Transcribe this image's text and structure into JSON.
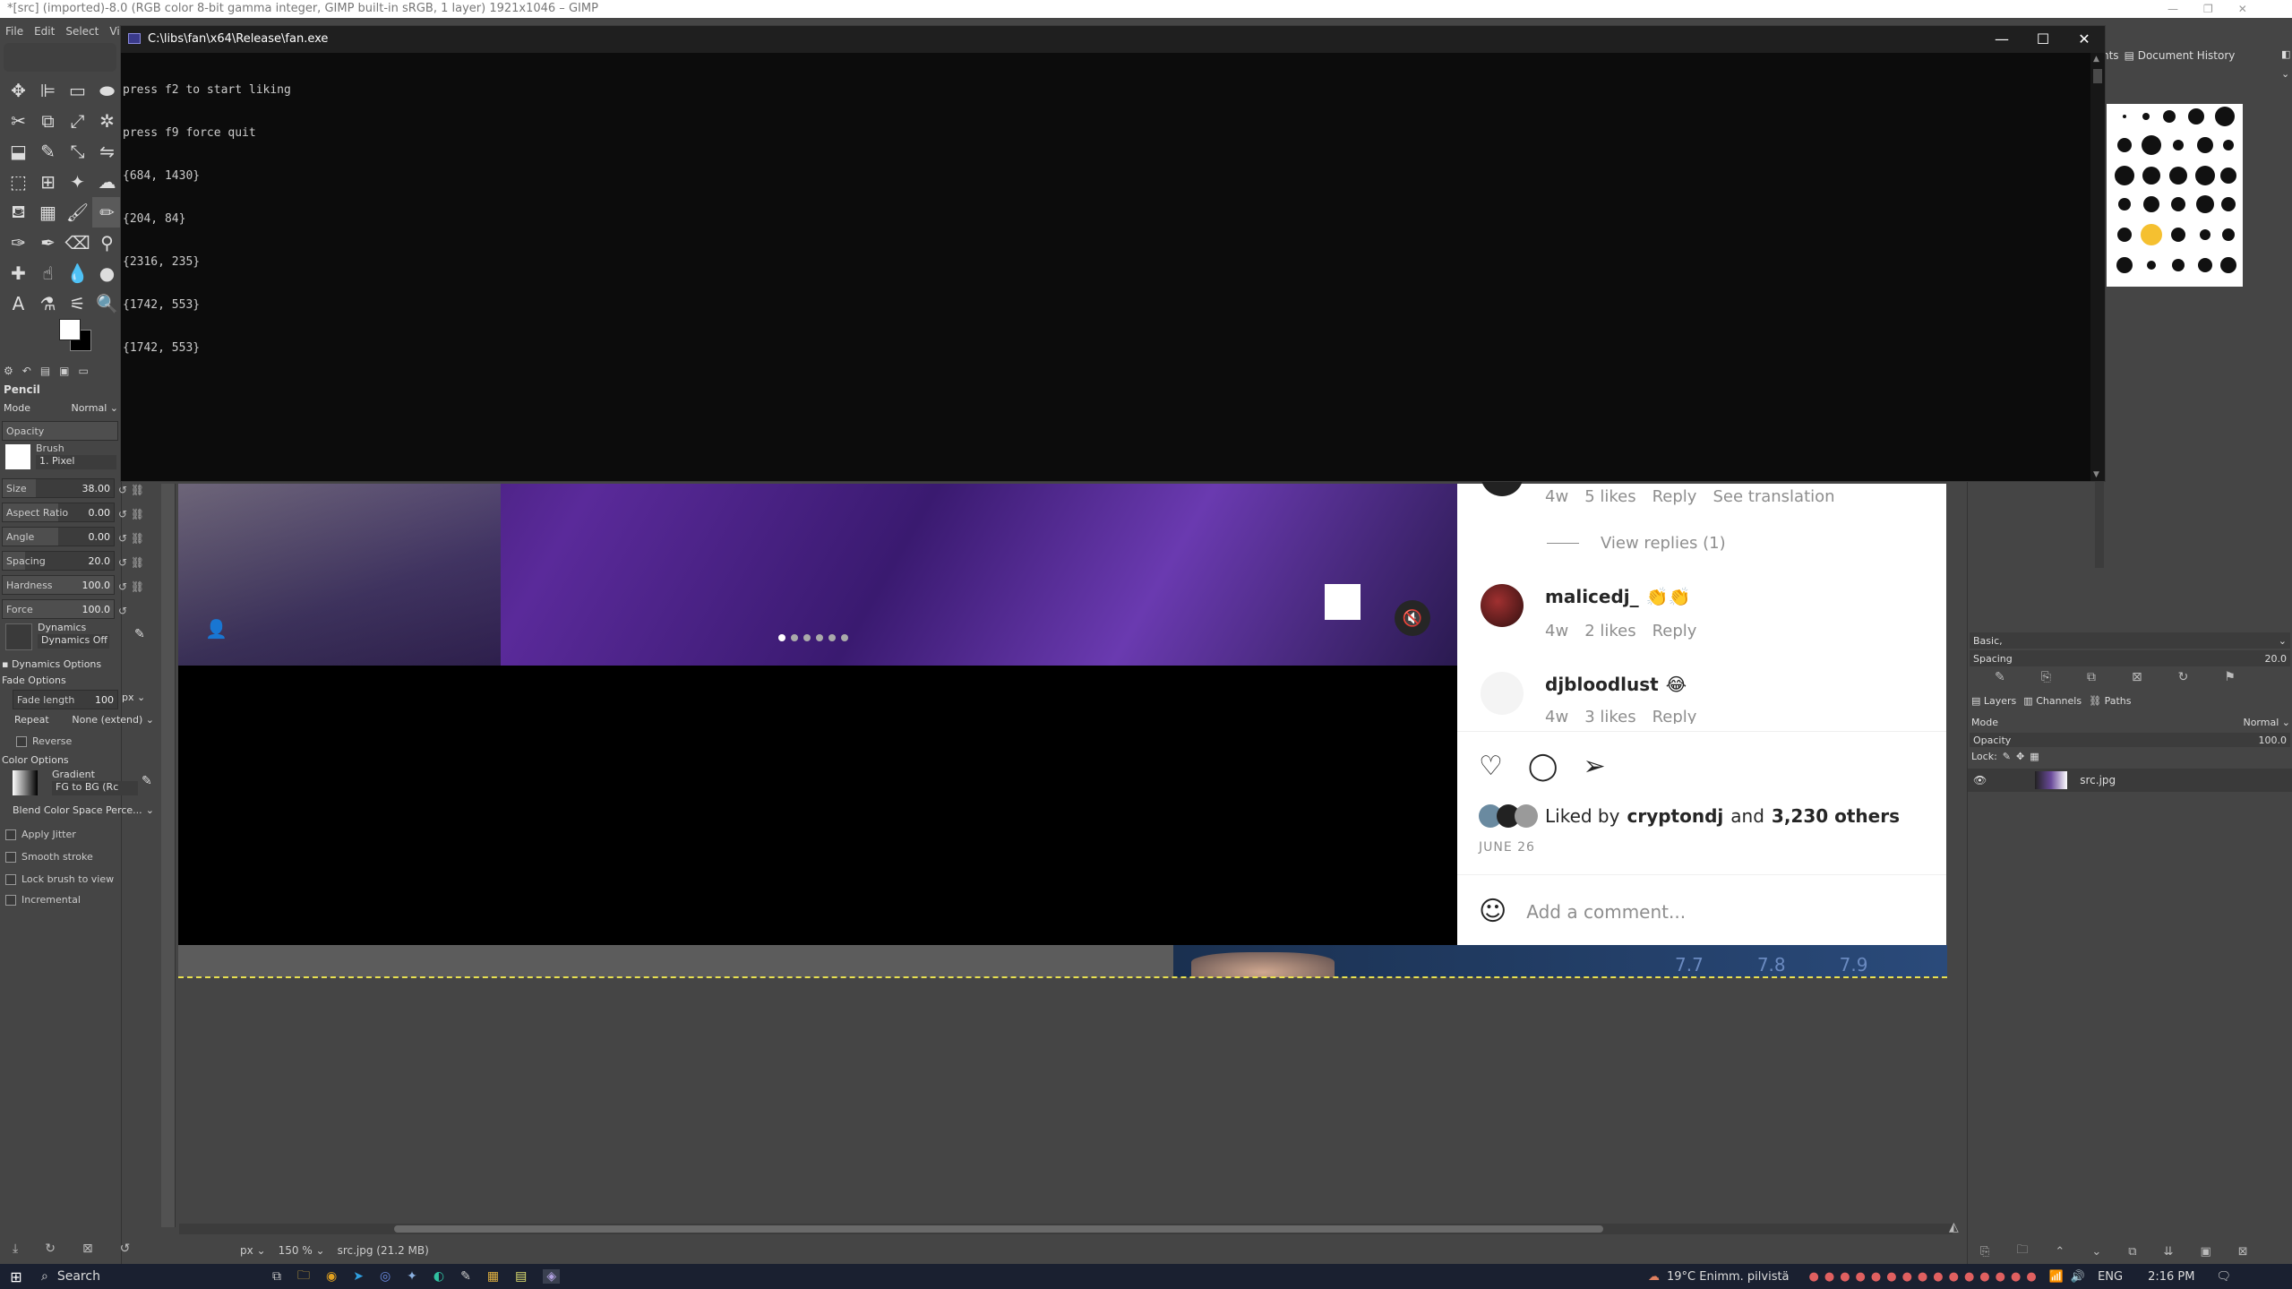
{
  "gimp": {
    "title": "*[src] (imported)-8.0 (RGB color 8-bit gamma integer, GIMP built-in sRGB, 1 layer) 1921x1046 – GIMP",
    "menu": [
      "File",
      "Edit",
      "Select",
      "View"
    ],
    "tool_options": {
      "tool_name": "Pencil",
      "mode_label": "Mode",
      "mode_value": "Normal",
      "opacity_label": "Opacity",
      "brush_label": "Brush",
      "brush_value": "1. Pixel",
      "size_label": "Size",
      "size_value": "38.00",
      "aspect_label": "Aspect Ratio",
      "aspect_value": "0.00",
      "angle_label": "Angle",
      "angle_value": "0.00",
      "spacing_label": "Spacing",
      "spacing_value": "20.0",
      "hardness_label": "Hardness",
      "hardness_value": "100.0",
      "force_label": "Force",
      "force_value": "100.0",
      "dynamics_label": "Dynamics",
      "dynamics_value": "Dynamics Off",
      "dynamics_options": "Dynamics Options",
      "fade_options": "Fade Options",
      "fade_length_label": "Fade length",
      "fade_length_value": "100",
      "fade_unit": "px",
      "repeat_label": "Repeat",
      "repeat_value": "None (extend)",
      "reverse_label": "Reverse",
      "color_options": "Color Options",
      "gradient_label": "Gradient",
      "gradient_value": "FG to BG (Rc",
      "blend_space": "Blend Color Space Perce...",
      "apply_jitter": "Apply Jitter",
      "smooth_stroke": "Smooth stroke",
      "lock_brush": "Lock brush to view",
      "incremental": "Incremental"
    },
    "status": {
      "unit": "px",
      "zoom": "150 %",
      "file_info": "src.jpg (21.2 MB)"
    },
    "right_dock": {
      "tab_doc_history": "Document History",
      "tab_prefix": "nts",
      "brush_preset": "Basic,",
      "spacing_label": "Spacing",
      "spacing_value": "20.0",
      "tabs": [
        "Layers",
        "Channels",
        "Paths"
      ],
      "mode_label": "Mode",
      "mode_value": "Normal",
      "opacity_label": "Opacity",
      "opacity_value": "100.0",
      "lock_label": "Lock:",
      "layer_name": "src.jpg"
    }
  },
  "console": {
    "title": "C:\\libs\\fan\\x64\\Release\\fan.exe",
    "lines": [
      "press f2 to start liking",
      "press f9 force quit",
      "{684, 1430}",
      "{204, 84}",
      "{2316, 235}",
      "{1742, 553}",
      "{1742, 553}"
    ]
  },
  "instagram": {
    "comment1": {
      "time": "4w",
      "likes": "5 likes",
      "reply": "Reply",
      "translate": "See translation"
    },
    "view_replies": "View replies (1)",
    "comment2": {
      "user": "malicedj_",
      "text": "👏👏",
      "time": "4w",
      "likes": "2 likes",
      "reply": "Reply"
    },
    "comment3": {
      "user": "djbloodlust",
      "text": "😂",
      "time": "4w",
      "likes": "3 likes",
      "reply": "Reply"
    },
    "liked_by_prefix": "Liked by",
    "liked_by_user": "cryptondj",
    "liked_by_and": "and",
    "liked_by_others": "3,230 others",
    "date": "JUNE 26",
    "add_comment": "Add a comment...",
    "strip_labels": [
      "7.7",
      "7.8",
      "7.9"
    ]
  },
  "taskbar": {
    "search": "Search",
    "weather": "19°C  Enimm. pilvistä",
    "lang": "ENG",
    "time": "2:16 PM"
  }
}
